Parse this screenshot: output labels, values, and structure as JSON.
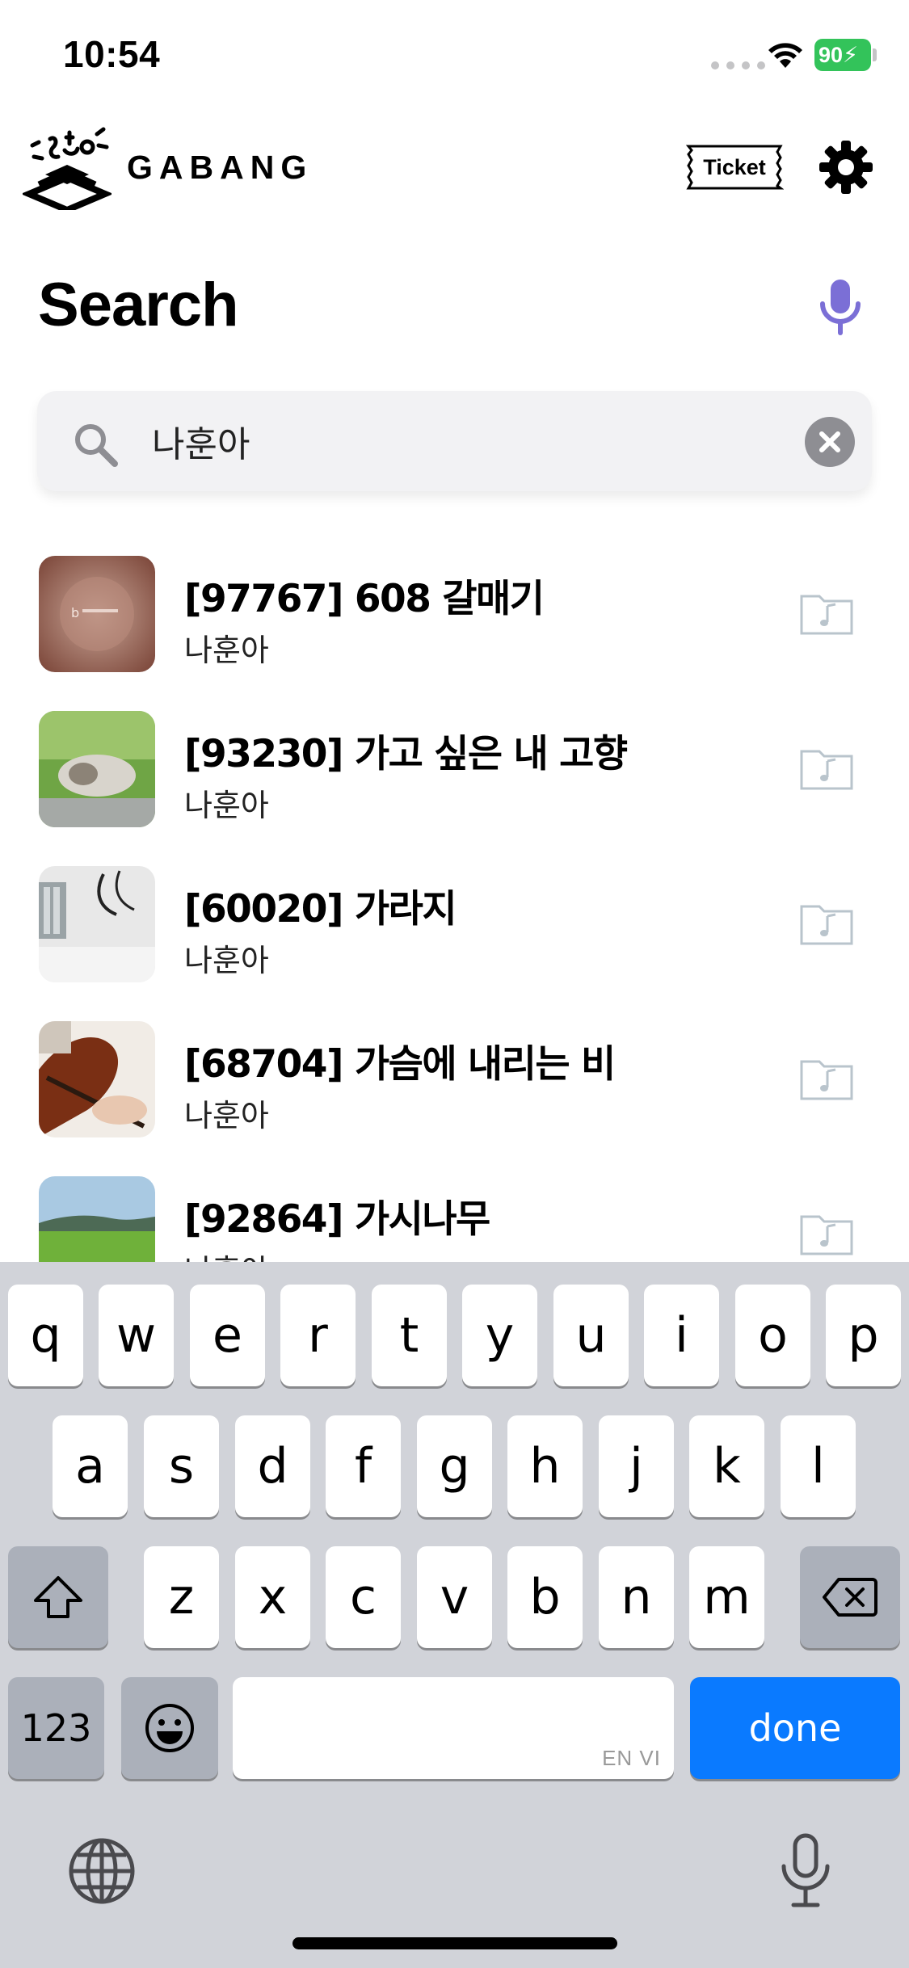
{
  "status_bar": {
    "time": "10:54",
    "battery": "90"
  },
  "header": {
    "logo_text": "GABANG",
    "ticket_label": "Ticket"
  },
  "search": {
    "title": "Search",
    "query": "나훈아"
  },
  "results": [
    {
      "title": "[97767] 608 갈매기",
      "artist": "나훈아"
    },
    {
      "title": "[93230] 가고 싶은 내 고향",
      "artist": "나훈아"
    },
    {
      "title": "[60020] 가라지",
      "artist": "나훈아"
    },
    {
      "title": "[68704] 가슴에 내리는 비",
      "artist": "나훈아"
    },
    {
      "title": "[92864] 가시나무",
      "artist": "나훈아"
    }
  ],
  "keyboard": {
    "row1": [
      "q",
      "w",
      "e",
      "r",
      "t",
      "y",
      "u",
      "i",
      "o",
      "p"
    ],
    "row2": [
      "a",
      "s",
      "d",
      "f",
      "g",
      "h",
      "j",
      "k",
      "l"
    ],
    "row3": [
      "z",
      "x",
      "c",
      "v",
      "b",
      "n",
      "m"
    ],
    "numbers_label": "123",
    "done_label": "done",
    "space_hint": "EN VI"
  },
  "colors": {
    "accent": "#7b6fd6",
    "done_key": "#0a7aff",
    "battery": "#33c35a"
  },
  "icons": [
    "wifi-icon",
    "search-icon",
    "clear-icon",
    "microphone-icon",
    "gear-icon",
    "ticket-icon",
    "music-folder-icon",
    "shift-icon",
    "backspace-icon",
    "emoji-icon",
    "globe-icon"
  ]
}
